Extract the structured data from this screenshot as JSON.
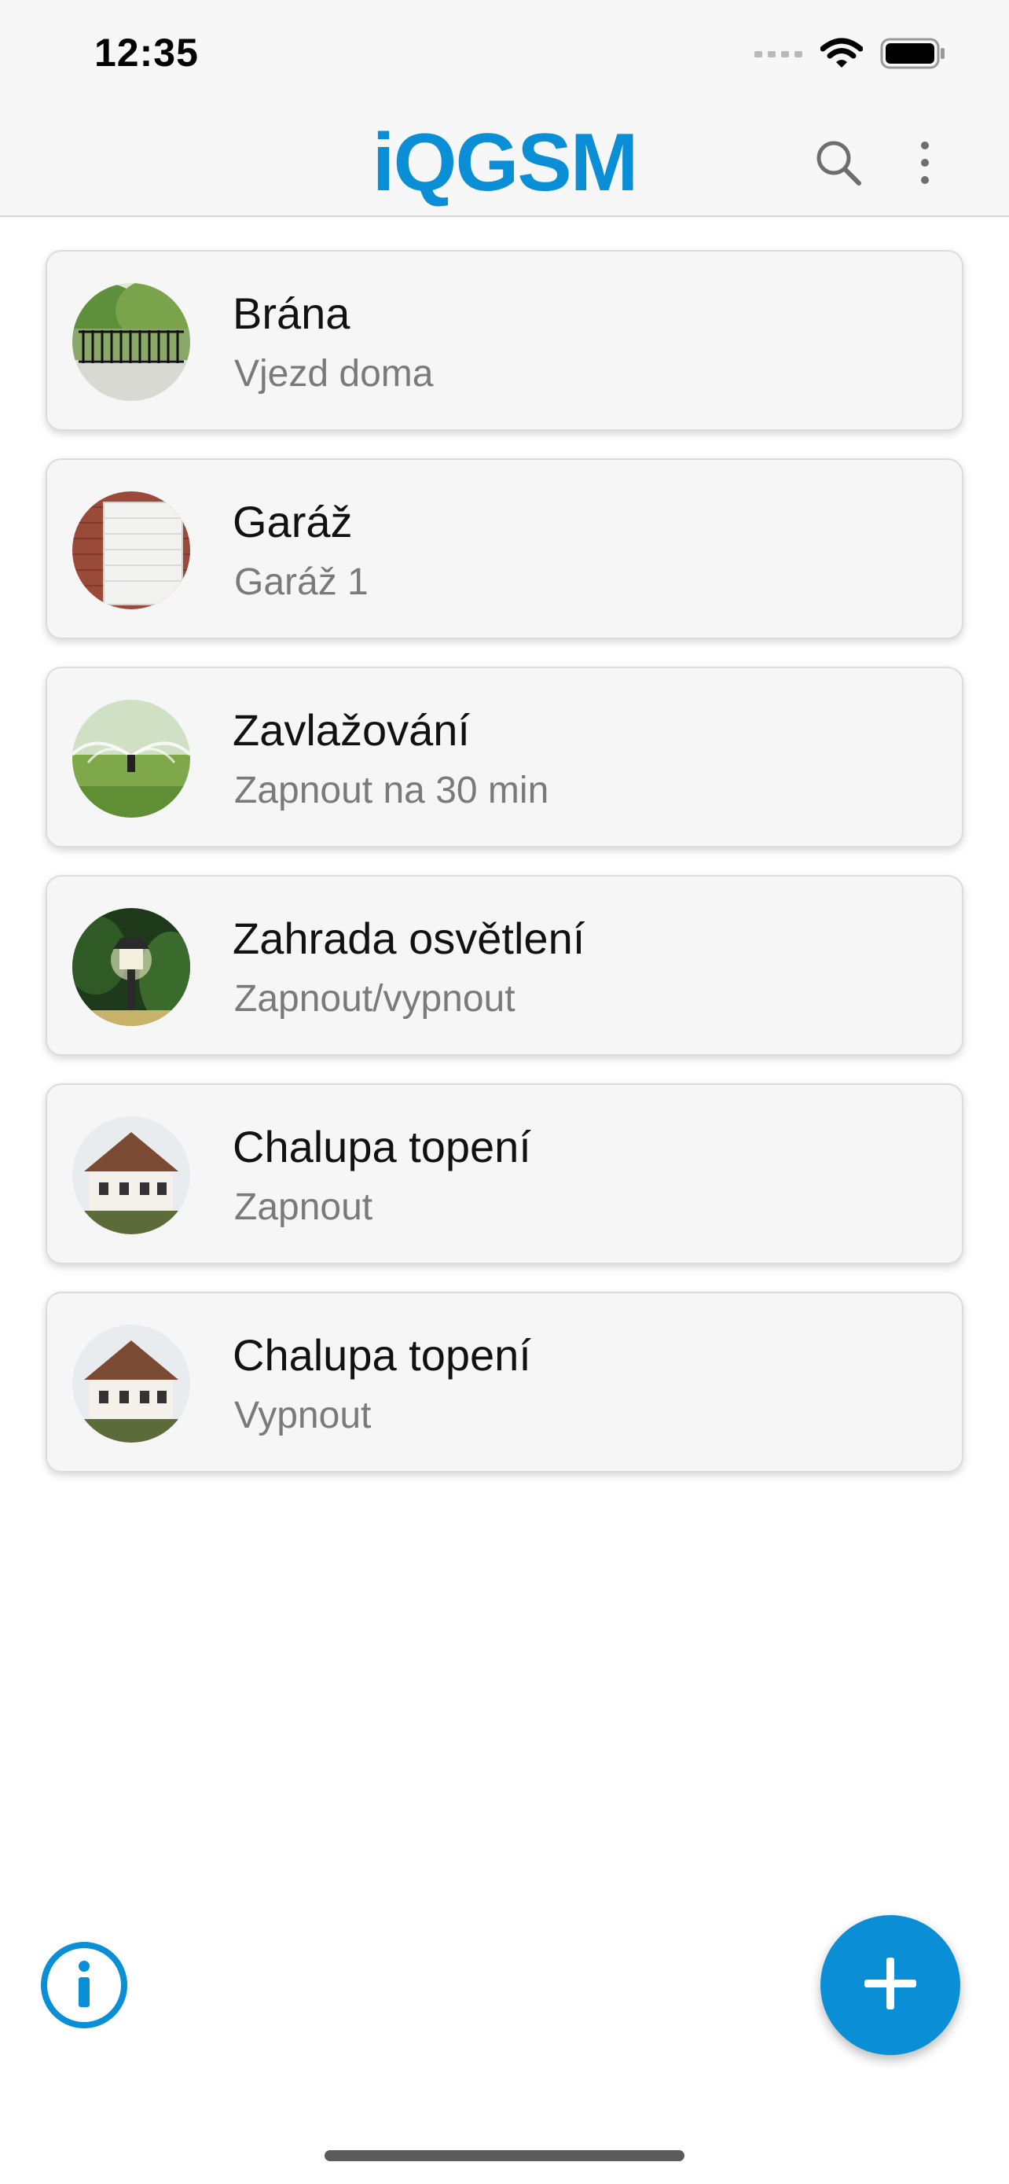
{
  "status_bar": {
    "time": "12:35",
    "icons": [
      "signal-dots-icon",
      "wifi-icon",
      "battery-icon"
    ]
  },
  "header": {
    "title": "iQGSM",
    "title_color": "#0a8fd6",
    "actions": [
      "search-icon",
      "more-vertical-icon"
    ]
  },
  "devices": [
    {
      "name": "Brána",
      "action": "Vjezd doma",
      "image": "gate-photo"
    },
    {
      "name": "Garáž",
      "action": "Garáž 1",
      "image": "garage-door-photo"
    },
    {
      "name": "Zavlažování",
      "action": "Zapnout na 30 min",
      "image": "sprinkler-photo"
    },
    {
      "name": "Zahrada osvětlení",
      "action": "Zapnout/vypnout",
      "image": "garden-lamp-photo"
    },
    {
      "name": "Chalupa topení",
      "action": "Zapnout",
      "image": "cottage-photo"
    },
    {
      "name": "Chalupa topení",
      "action": "Vypnout",
      "image": "cottage-photo"
    }
  ],
  "bottom": {
    "info_icon": "info-icon",
    "add_icon": "plus-icon",
    "accent": "#0a8fd6"
  }
}
